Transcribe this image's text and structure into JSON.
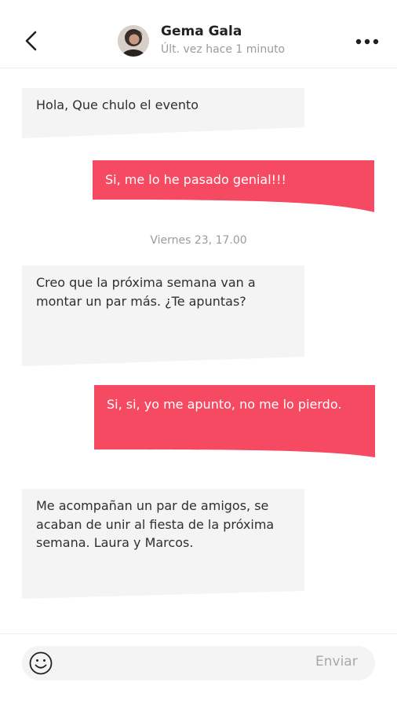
{
  "header": {
    "back_icon": "chevron-left-icon",
    "contact_name": "Gema Gala",
    "status": "Últ. vez hace 1 minuto",
    "more_icon": "more-horizontal-icon"
  },
  "messages": [
    {
      "direction": "incoming",
      "text": "Hola, Que chulo el evento"
    },
    {
      "direction": "outgoing",
      "text": "Si, me lo he pasado genial!!!"
    },
    {
      "direction": "incoming",
      "text": "Creo que la próxima semana van a montar un par más. ¿Te apuntas?"
    },
    {
      "direction": "outgoing",
      "text": "Si, si, yo me apunto, no me lo pierdo."
    },
    {
      "direction": "incoming",
      "text": "Me acompañan un par de amigos, se acaban de unir al fiesta de la próxima semana. Laura y Marcos."
    }
  ],
  "timestamp": "Viernes 23, 17.00",
  "composer": {
    "emoji_icon": "smiley-icon",
    "placeholder": "",
    "send_label": "Enviar"
  },
  "colors": {
    "accent": "#f54a62",
    "incoming_bubble": "#f4f4f4"
  }
}
